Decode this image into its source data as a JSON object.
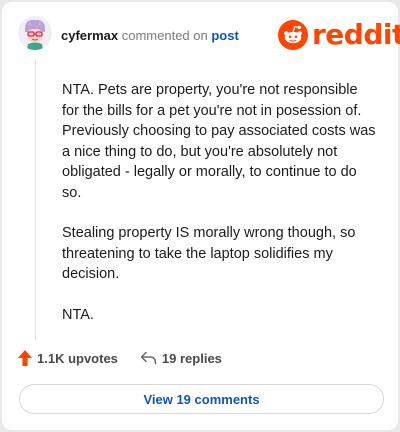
{
  "comment": {
    "username": "cyfermax",
    "action_text": "commented on",
    "post_link": "post",
    "paragraphs": [
      "NTA. Pets are property, you're not responsible for the bills for a pet you're not in posession of. Previously choosing to pay associated costs was a nice thing to do, but you're absolutely not obligated - legally or morally, to continue to do so.",
      "Stealing property IS morally wrong though, so threatening to take the laptop solidifies my decision.",
      "NTA."
    ]
  },
  "brand": {
    "wordmark": "reddit",
    "color": "#ff4500"
  },
  "actions": {
    "upvotes_label": "1.1K upvotes",
    "replies_label": "19 replies"
  },
  "footer": {
    "view_comments_label": "View 19 comments"
  },
  "icons": {
    "avatar": "avatar",
    "logo": "reddit-snoo-icon",
    "upvote": "upvote-arrow-icon",
    "reply": "reply-arrow-icon"
  },
  "colors": {
    "accent": "#ff4500",
    "link": "#0f56b8",
    "text": "#1c1c1c",
    "muted": "#7c7c7c"
  }
}
